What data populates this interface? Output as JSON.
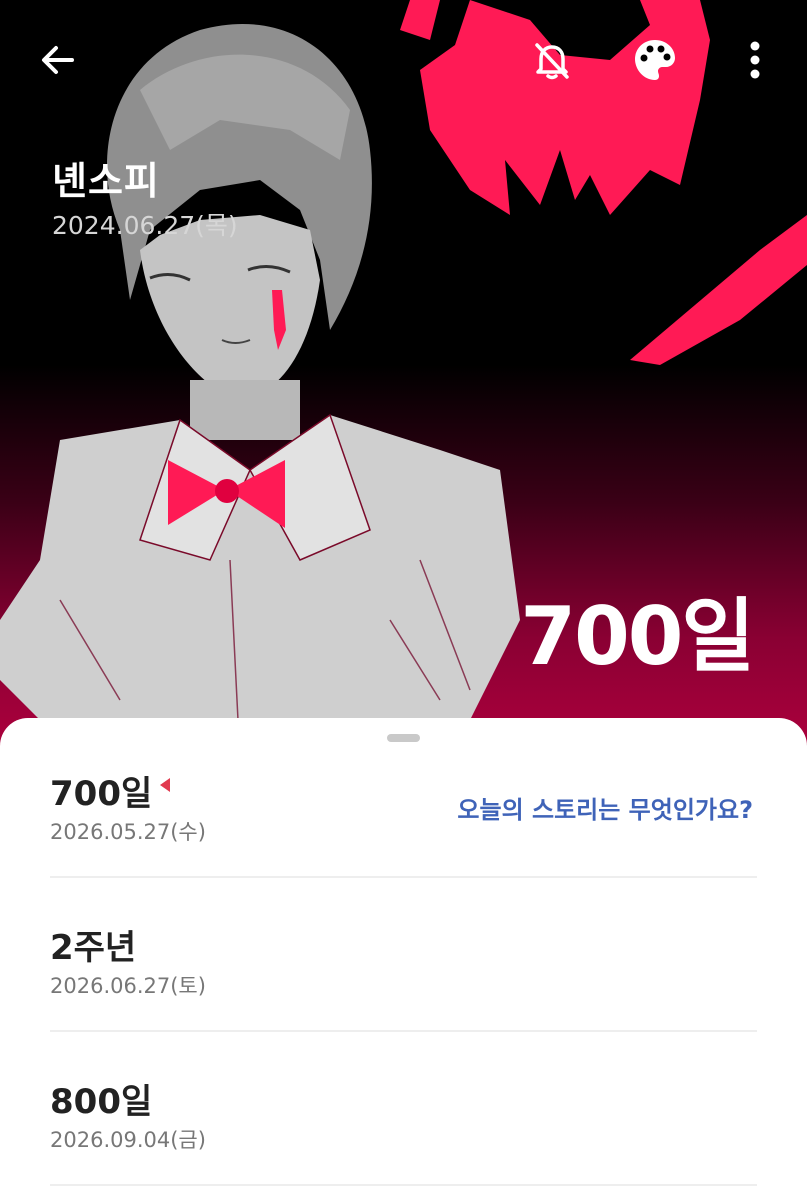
{
  "header": {
    "back_icon": "arrow-left-icon",
    "notification_icon": "bell-off-icon",
    "theme_icon": "palette-icon",
    "more_icon": "more-vertical-icon"
  },
  "anniversary": {
    "title": "녠소피",
    "start_date": "2024.06.27(목)",
    "current_count": "700일"
  },
  "milestones": [
    {
      "label": "700일",
      "date": "2026.05.27(수)",
      "is_today": true,
      "link": "오늘의 스토리는 무엇인가요?"
    },
    {
      "label": "2주년",
      "date": "2026.06.27(토)"
    },
    {
      "label": "800일",
      "date": "2026.09.04(금)"
    }
  ],
  "colors": {
    "accent_pink": "#ff1a55",
    "link_blue": "#3f63b8",
    "today_marker": "#e13a4f"
  }
}
